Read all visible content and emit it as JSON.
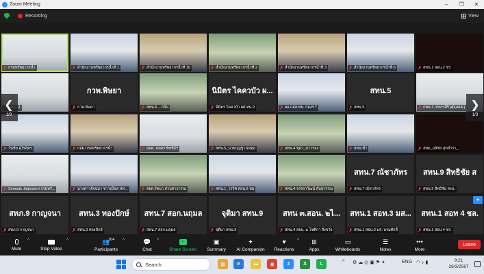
{
  "window": {
    "title": "Zoom Meeting",
    "minimize": "–",
    "maximize": "❐",
    "close": "✕"
  },
  "topbar": {
    "recording": "Recording",
    "view": "View"
  },
  "gallery": {
    "page_left": "1/3",
    "page_right": "1/3",
    "tiles": [
      {
        "label": "กรมทรัพยากรน้ำ",
        "style": "v5",
        "active": true
      },
      {
        "label": "สำนักงานทรัพยากรน้ำที่ 1",
        "style": "v2"
      },
      {
        "label": "สำนักงานทรัพยากรน้ำที่ 10",
        "style": "v3"
      },
      {
        "label": "สำนักงานทรัพยากรน้ำที่ 2",
        "style": "v4"
      },
      {
        "label": "สำนักงานทรัพยากรน้ำที่ 3",
        "style": "v3"
      },
      {
        "label": "สำนักงานทรัพยากรน้ำที่ 6",
        "style": "v2"
      },
      {
        "label": "สทน.1 สอน.2 ชร.",
        "style": "dark"
      },
      {
        "label": "สทน.11",
        "style": "v5"
      },
      {
        "label": "กวพ.พิษยา",
        "big": "กวพ.พิษยา",
        "style": "plain"
      },
      {
        "label": "สทน.6 ...กปิน",
        "style": "v4"
      },
      {
        "label": "นิมิตร ไคควบัว ผศ.ทน.9",
        "big": "นิมิตร ไคควบัว ผ...",
        "style": "plain"
      },
      {
        "label": "ผอ.กสส.ทน. กองฯ 7",
        "style": "v2"
      },
      {
        "label": "สทน.5",
        "big": "สทน.5",
        "style": "plain"
      },
      {
        "label": "กพน.1 กรมฯ ศิริวุฒิ(สอค.)",
        "style": "v5"
      },
      {
        "label": "วันชัย อุไรฉัตร",
        "style": "v2"
      },
      {
        "label": "กอม.กรมทรัพยากรน้ำ",
        "style": "v3"
      },
      {
        "label": "สอค. นพดร พิทซิธีร์",
        "style": "v5"
      },
      {
        "label": "สทน.5_นายบุญชู กองพุธ",
        "style": "v3"
      },
      {
        "label": "สทน.4 ชุดา_นาวรอง",
        "style": "v4"
      },
      {
        "label": "สทน.ฟ้า",
        "style": "v2"
      },
      {
        "label": "สทด_อลัชย สุขสำรา_",
        "style": "dark"
      },
      {
        "label": "Sorasak Jaiprasert กรมทรั...",
        "style": "v5"
      },
      {
        "label": "นางสาวอัจฉมา ชาวเมือง/ สท...",
        "style": "v2"
      },
      {
        "label": "สอด.รัตนา ส่วนสาธารณ",
        "style": "v4"
      },
      {
        "label": "สทน.1_วรวิศ สอน.2 ชม",
        "style": "v2"
      },
      {
        "label": "สทน.4 จรรยาวัฒน์ อันสุวรรณ",
        "style": "v4"
      },
      {
        "label": "สทน.7 ณัชาภัทร",
        "big": "สทน.7 ณัชาภัทร",
        "style": "plain"
      },
      {
        "label": "สทน.9 สิทธิชัย สงน.",
        "big": "สทน.9 สิทธิชัย ส",
        "style": "plain"
      },
      {
        "label": "สทภ.9 กาญจนา",
        "big": "สทภ.9 กาญจนา",
        "style": "plain"
      },
      {
        "label": "สทน.3 ทองปักษ์",
        "big": "สทน.3 ทองปักษ์",
        "style": "plain"
      },
      {
        "label": "สทน.7 สอก.นฤมล",
        "big": "สทน.7 สอก.นฤมล",
        "style": "plain"
      },
      {
        "label": "จุติมา สทน.9",
        "big": "จุติมา สทน.9",
        "style": "plain"
      },
      {
        "label": "สทน.4 สอน. ๒ โซติกา สังขวัง",
        "big": "สทน ๓.สอน. ๒ไ...",
        "style": "plain"
      },
      {
        "label": "สทน.1 สอน.3 มส. พรมศักดิ์",
        "big": "สทน.1 สอท.3 มส...",
        "style": "plain"
      },
      {
        "label": "สทน.1 สอน 4 ชร.",
        "big": "สทน.1 สอท 4 ชล.",
        "style": "plain"
      }
    ]
  },
  "toolbar": {
    "mute": "Mute",
    "stop_video": "Stop Video",
    "participants": "Participants",
    "participants_count": "104",
    "chat": "Chat",
    "share_screen": "Share Screen",
    "summary": "Summary",
    "ai_companion": "AI Companion",
    "reactions": "Reactions",
    "apps": "Apps",
    "whiteboards": "Whiteboards",
    "notes": "Notes",
    "more": "More",
    "leave": "Leave"
  },
  "taskbar": {
    "search_placeholder": "Search",
    "language": "ENG",
    "time": "9:21",
    "date": "28/3/2567"
  },
  "colors": {
    "active_border": "#b6e35a",
    "share_green": "#23d160",
    "leave_red": "#e02828",
    "zoom_blue": "#2d8cff"
  }
}
